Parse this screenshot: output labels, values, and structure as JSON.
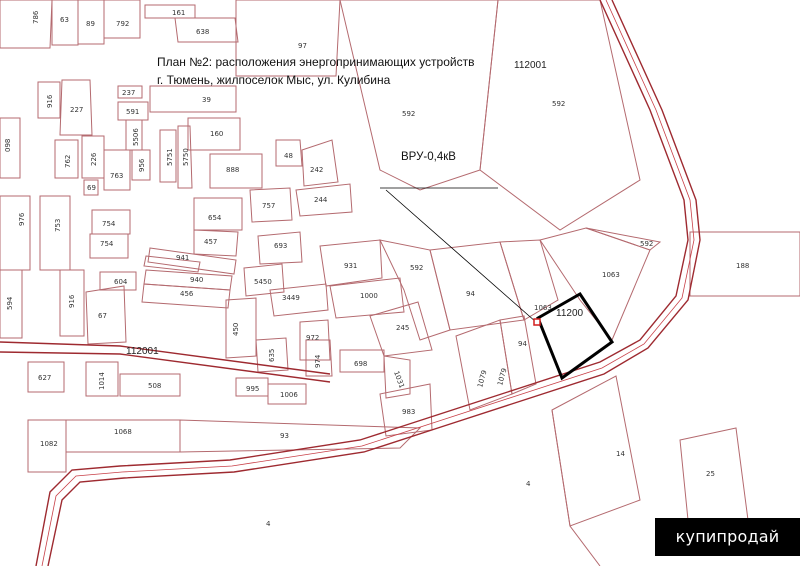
{
  "title": {
    "line1": "План №2: расположения энергопринимающих устройств",
    "line2": "г. Тюмень, жилпоселок Мыс, ул. Кулибина"
  },
  "device_label": "ВРУ-0,4кВ",
  "watermark": "купипродай",
  "quarters": [
    "112001",
    "112001",
    "11200"
  ],
  "colors": {
    "parcel_border": "#b46a6f",
    "road": "#9e2a30",
    "highlight_parcel": "#000000",
    "device_marker": "#d21e1e"
  },
  "parcel_labels": [
    "786",
    "63",
    "89",
    "792",
    "161",
    "638",
    "97",
    "592",
    "592",
    "916",
    "227",
    "237",
    "39",
    "591",
    "5506",
    "160",
    "098",
    "762",
    "226",
    "956",
    "5751",
    "5750",
    "763",
    "48",
    "242",
    "888",
    "69",
    "244",
    "757",
    "976",
    "753",
    "754",
    "654",
    "754",
    "457",
    "693",
    "941",
    "940",
    "456",
    "5450",
    "931",
    "592",
    "94",
    "1063",
    "1063",
    "592",
    "188",
    "594",
    "916",
    "604",
    "67",
    "3449",
    "1000",
    "245",
    "450",
    "972",
    "635",
    "974",
    "94",
    "1079",
    "1079",
    "698",
    "1031",
    "627",
    "1014",
    "508",
    "995",
    "1006",
    "983",
    "1082",
    "1068",
    "93",
    "14",
    "4",
    "25",
    "4",
    "112001"
  ]
}
